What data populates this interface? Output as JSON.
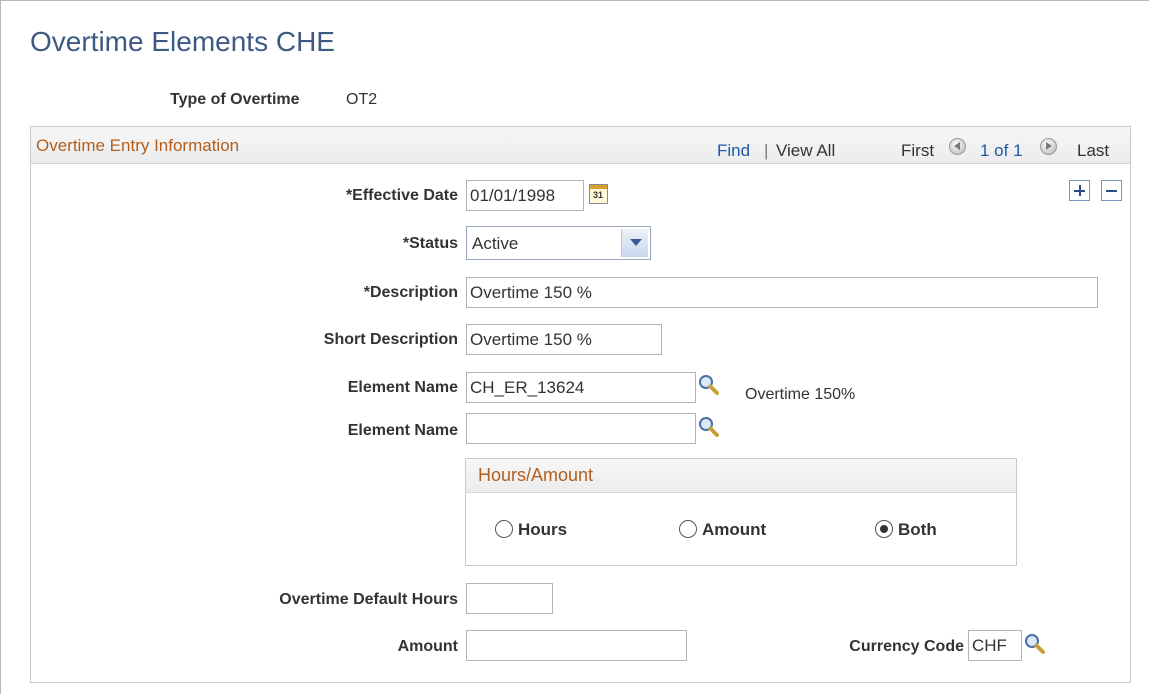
{
  "page": {
    "title": "Overtime Elements CHE"
  },
  "header_fields": {
    "type_of_overtime_label": "Type of Overtime",
    "type_of_overtime_value": "OT2"
  },
  "section": {
    "title": "Overtime Entry Information",
    "nav": {
      "find": "Find",
      "separator": "|",
      "view_all": "View All",
      "first": "First",
      "count": "1 of 1",
      "last": "Last"
    },
    "add_row_icon": "plus-icon",
    "delete_row_icon": "minus-icon"
  },
  "form": {
    "effective_date": {
      "label": "*Effective Date",
      "value": "01/01/1998",
      "calendar_icon_text": "31"
    },
    "status": {
      "label": "*Status",
      "value": "Active"
    },
    "description": {
      "label": "*Description",
      "value": "Overtime 150 %"
    },
    "short_description": {
      "label": "Short Description",
      "value": "Overtime 150 %"
    },
    "element_name_1": {
      "label": "Element Name",
      "value": "CH_ER_13624",
      "description": "Overtime 150%"
    },
    "element_name_2": {
      "label": "Element Name",
      "value": ""
    },
    "hours_amount": {
      "title": "Hours/Amount",
      "options": [
        {
          "label": "Hours",
          "selected": false
        },
        {
          "label": "Amount",
          "selected": false
        },
        {
          "label": "Both",
          "selected": true
        }
      ]
    },
    "overtime_default_hours": {
      "label": "Overtime Default Hours",
      "value": ""
    },
    "amount": {
      "label": "Amount",
      "value": ""
    },
    "currency_code": {
      "label": "Currency Code",
      "value": "CHF"
    }
  },
  "colors": {
    "title": "#3d5a83",
    "section_title": "#b35e1c",
    "link": "#1f58a6"
  }
}
